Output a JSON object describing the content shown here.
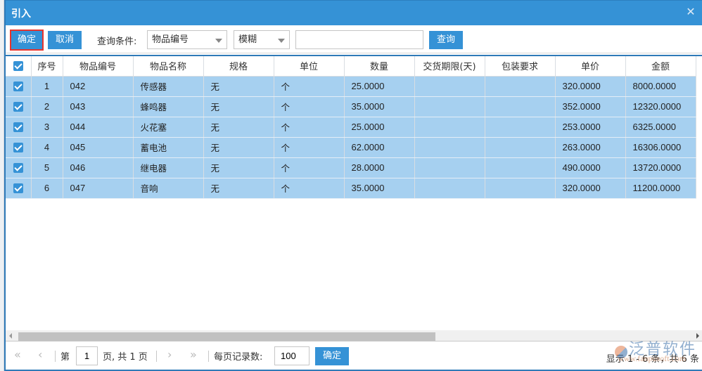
{
  "dialog": {
    "title": "引入",
    "close_icon": "close-icon"
  },
  "toolbar": {
    "ok_label": "确定",
    "cancel_label": "取消",
    "condition_label": "查询条件:",
    "field_select": "物品编号",
    "mode_select": "模糊",
    "search_value": "",
    "query_label": "查询"
  },
  "table": {
    "columns": [
      "",
      "序号",
      "物品编号",
      "物品名称",
      "规格",
      "单位",
      "数量",
      "交货期限(天)",
      "包装要求",
      "单价",
      "金额"
    ],
    "rows": [
      {
        "checked": true,
        "seq": "1",
        "code": "042",
        "name": "传感器",
        "spec": "无",
        "unit": "个",
        "qty": "25.0000",
        "delivery": "",
        "packing": "",
        "price": "320.0000",
        "amount": "8000.0000"
      },
      {
        "checked": true,
        "seq": "2",
        "code": "043",
        "name": "蜂鸣器",
        "spec": "无",
        "unit": "个",
        "qty": "35.0000",
        "delivery": "",
        "packing": "",
        "price": "352.0000",
        "amount": "12320.0000"
      },
      {
        "checked": true,
        "seq": "3",
        "code": "044",
        "name": "火花塞",
        "spec": "无",
        "unit": "个",
        "qty": "25.0000",
        "delivery": "",
        "packing": "",
        "price": "253.0000",
        "amount": "6325.0000"
      },
      {
        "checked": true,
        "seq": "4",
        "code": "045",
        "name": "蓄电池",
        "spec": "无",
        "unit": "个",
        "qty": "62.0000",
        "delivery": "",
        "packing": "",
        "price": "263.0000",
        "amount": "16306.0000"
      },
      {
        "checked": true,
        "seq": "5",
        "code": "046",
        "name": "继电器",
        "spec": "无",
        "unit": "个",
        "qty": "28.0000",
        "delivery": "",
        "packing": "",
        "price": "490.0000",
        "amount": "13720.0000"
      },
      {
        "checked": true,
        "seq": "6",
        "code": "047",
        "name": "音响",
        "spec": "无",
        "unit": "个",
        "qty": "35.0000",
        "delivery": "",
        "packing": "",
        "price": "320.0000",
        "amount": "11200.0000"
      }
    ]
  },
  "pager": {
    "first_icon": "«",
    "prev_icon": "‹",
    "next_icon": "›",
    "last_icon": "»",
    "page_prefix": "第",
    "page_value": "1",
    "page_suffix": "页, 共 1 页",
    "per_page_label": "每页记录数:",
    "per_page_value": "100",
    "ok_label": "确定",
    "status": "显示 1 - 6 条，共 6 条"
  },
  "watermark": {
    "brand": "泛普软件",
    "url": "www.fanpusoft.com"
  },
  "colors": {
    "accent": "#3592d6",
    "selected_row": "#a6d0f0",
    "highlight_border": "#e8332c"
  }
}
